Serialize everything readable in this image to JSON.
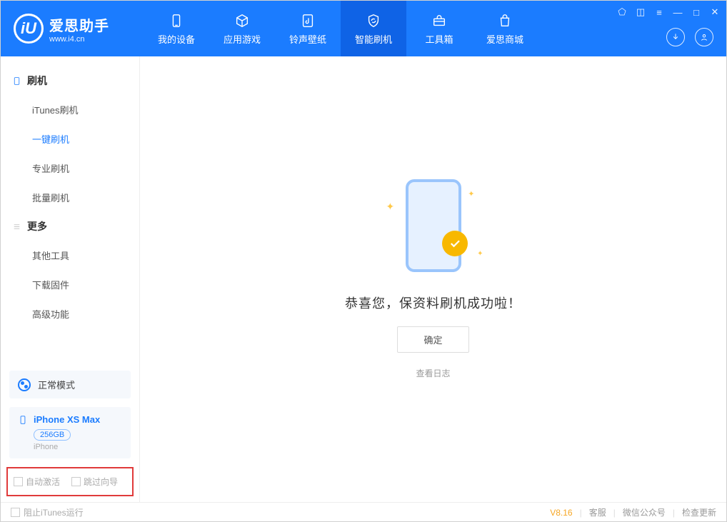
{
  "app": {
    "name": "爱思助手",
    "url": "www.i4.cn"
  },
  "nav": [
    {
      "label": "我的设备"
    },
    {
      "label": "应用游戏"
    },
    {
      "label": "铃声壁纸"
    },
    {
      "label": "智能刷机"
    },
    {
      "label": "工具箱"
    },
    {
      "label": "爱思商城"
    }
  ],
  "sidebar": {
    "section1": {
      "title": "刷机",
      "items": [
        "iTunes刷机",
        "一键刷机",
        "专业刷机",
        "批量刷机"
      ]
    },
    "section2": {
      "title": "更多",
      "items": [
        "其他工具",
        "下载固件",
        "高级功能"
      ]
    },
    "mode": "正常模式",
    "device": {
      "name": "iPhone XS Max",
      "capacity": "256GB",
      "type": "iPhone"
    },
    "options": {
      "auto_activate": "自动激活",
      "skip_wizard": "跳过向导"
    }
  },
  "main": {
    "success": "恭喜您，保资料刷机成功啦！",
    "ok": "确定",
    "view_log": "查看日志"
  },
  "footer": {
    "block_itunes": "阻止iTunes运行",
    "version": "V8.16",
    "links": [
      "客服",
      "微信公众号",
      "检查更新"
    ]
  }
}
